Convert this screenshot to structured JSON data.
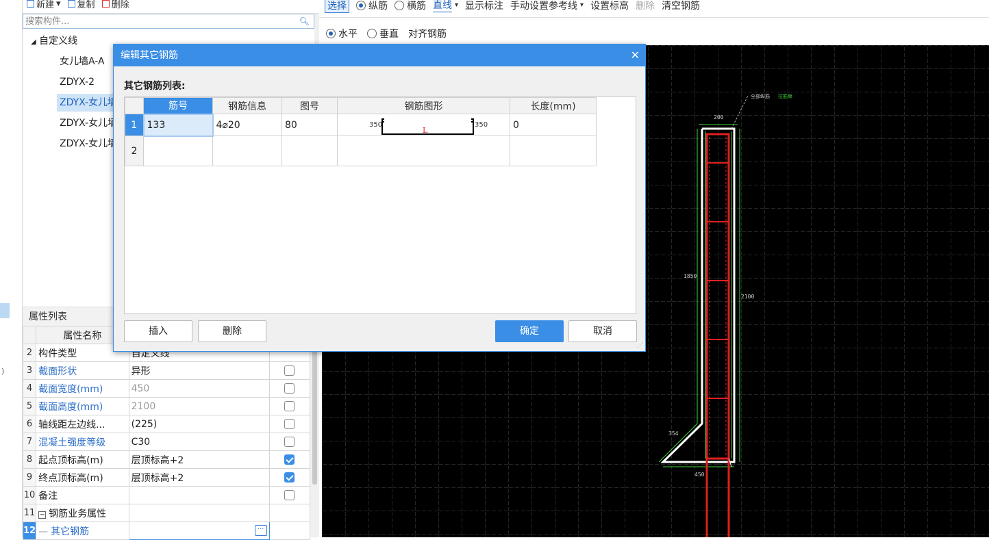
{
  "component_panel": {
    "toolbar": {
      "new_label": "新建",
      "copy_label": "复制",
      "delete_label": "删除"
    },
    "search_placeholder": "搜索构件...",
    "tree": {
      "root_label": "自定义线",
      "items": [
        "女儿墙A-A",
        "ZDYX-2",
        "ZDYX-女儿墙",
        "ZDYX-女儿墙",
        "ZDYX-女儿墙"
      ]
    }
  },
  "property_panel": {
    "title": "属性列表",
    "header_name": "属性名称",
    "rows": [
      {
        "num": "2",
        "name": "构件类型",
        "value": "自定义线"
      },
      {
        "num": "3",
        "name": "截面形状",
        "value": "异形"
      },
      {
        "num": "4",
        "name": "截面宽度(mm)",
        "value": "450"
      },
      {
        "num": "5",
        "name": "截面高度(mm)",
        "value": "2100"
      },
      {
        "num": "6",
        "name": "轴线距左边线...",
        "value": "(225)"
      },
      {
        "num": "7",
        "name": "混凝土强度等级",
        "value": "C30"
      },
      {
        "num": "8",
        "name": "起点顶标高(m)",
        "value": "层顶标高+2"
      },
      {
        "num": "9",
        "name": "终点顶标高(m)",
        "value": "层顶标高+2"
      },
      {
        "num": "10",
        "name": "备注",
        "value": ""
      },
      {
        "num": "11",
        "name": "钢筋业务属性",
        "value": ""
      },
      {
        "num": "12",
        "name": "其它钢筋",
        "value": ""
      }
    ]
  },
  "draw_toolbar": {
    "select": "选择",
    "longitudinal": "纵筋",
    "transverse": "横筋",
    "line": "直线",
    "show_label": "显示标注",
    "manual_ref": "手动设置参考线",
    "set_elev": "设置标高",
    "delete": "删除",
    "clear": "清空钢筋",
    "horizontal": "水平",
    "vertical": "垂直",
    "align": "对齐钢筋"
  },
  "canvas": {
    "dims": {
      "top": "200",
      "height": "1850",
      "total": "2100",
      "slope": "354",
      "base": "450"
    },
    "legend": {
      "all": "全部纵筋",
      "bar": "拉筋束"
    }
  },
  "dialog": {
    "title": "编辑其它钢筋",
    "subtitle": "其它钢筋列表:",
    "columns": [
      "筋号",
      "钢筋信息",
      "图号",
      "钢筋图形",
      "长度(mm)"
    ],
    "rows": [
      {
        "num": "1",
        "bar_no": "133",
        "info": "4⌀20",
        "fig_no": "80",
        "shape_left": "350",
        "shape_mid": "L",
        "shape_right": "350",
        "length": "0"
      },
      {
        "num": "2",
        "bar_no": "",
        "info": "",
        "fig_no": "",
        "shape_left": "",
        "shape_mid": "",
        "shape_right": "",
        "length": ""
      }
    ],
    "buttons": {
      "insert": "插入",
      "delete": "删除",
      "ok": "确定",
      "cancel": "取消"
    }
  }
}
